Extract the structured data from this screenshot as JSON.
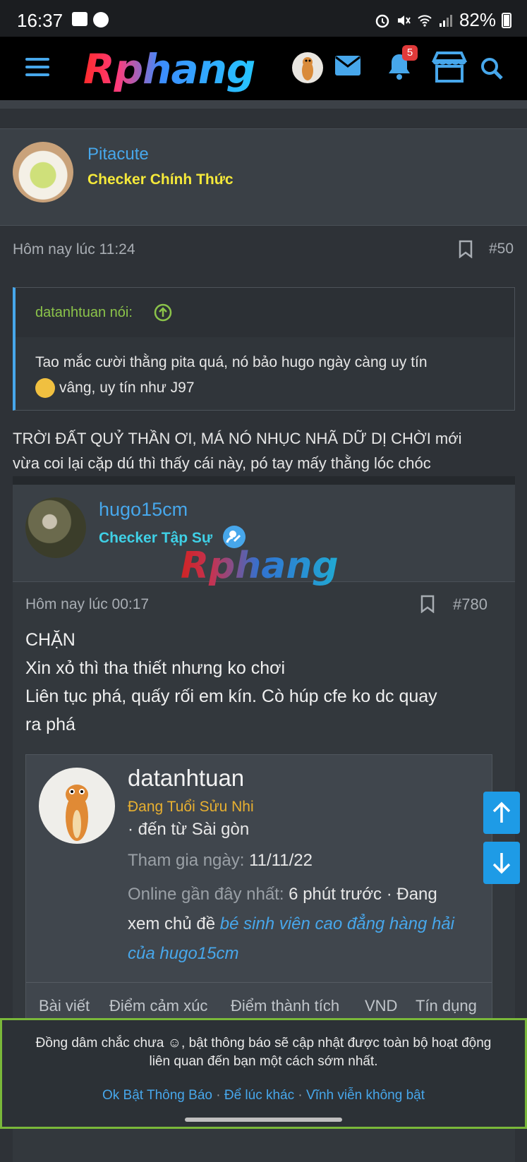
{
  "status_bar": {
    "time": "16:37",
    "battery": "82%"
  },
  "app_bar": {
    "logo": "Rphang",
    "notification_count": "5"
  },
  "post": {
    "author": "Pitacute",
    "author_title": "Checker Chính Thức",
    "author_title_color": "#f5e93a",
    "timestamp": "Hôm nay lúc 11:24",
    "number": "#50",
    "quote": {
      "author": "datanhtuan nói:",
      "line1": "Tao mắc cười thằng pita quá, nó bảo hugo ngày càng uy tín",
      "line2": "vâng, uy tín như J97"
    },
    "body_line1": "TRỜI ĐẤT QUỶ THẦN ƠI, MÁ NÓ NHỤC NHÃ DỮ DỊ CHỜI mới",
    "body_line2": "vừa coi lại cặp dú thì thấy cái này, pó tay mấy thằng lóc chóc"
  },
  "embedded_post": {
    "author": "hugo15cm",
    "author_title": "Checker Tập Sự",
    "author_title_color": "#3fd0e6",
    "watermark": "Rphang",
    "timestamp": "Hôm nay lúc 00:17",
    "number": "#780",
    "lines": [
      "CHẶN",
      "Xin xỏ thì tha thiết nhưng ko chơi",
      "Liên tục phá, quấy rối em kín. Cò húp cfe ko dc quay",
      "ra phá"
    ]
  },
  "member_tooltip": {
    "name": "datanhtuan",
    "rank": "Đang Tuổi Sửu Nhi",
    "rank_color": "#e8b030",
    "location": "· đến từ Sài gòn",
    "joined_label": "Tham gia ngày:",
    "joined_value": "11/11/22",
    "online_label": "Online gần đây nhất:",
    "online_value": "6 phút trước · Đang",
    "activity_prefix": "xem chủ đề",
    "activity_link_1": "bé sinh viên cao đẳng hàng hải",
    "activity_link_2": "của hugo15cm",
    "tabs": [
      "Bài viết",
      "Điểm cảm xúc",
      "Điểm thành tích",
      "VND",
      "Tín dụng"
    ]
  },
  "cookie_banner": {
    "message_1": "Đồng dâm chắc chưa ☺, bật thông báo sẽ cập nhật được toàn bộ hoạt động",
    "message_2": "liên quan đến bạn một cách sớm nhất.",
    "action_1": "Ok Bật Thông Báo",
    "action_2": "Để lúc khác",
    "action_3": "Vĩnh viễn không bật",
    "separator": "·",
    "border_color": "#7ab83a"
  },
  "accent_color": "#47a7eb"
}
